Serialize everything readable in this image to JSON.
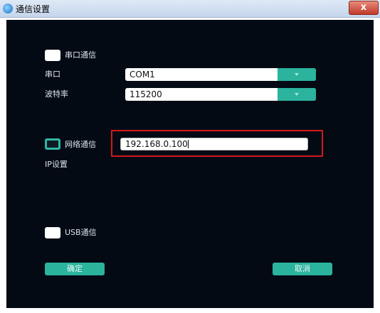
{
  "window": {
    "title": "通信设置",
    "close_label": "x"
  },
  "serial": {
    "checkbox_label": "串口通信",
    "port_label": "串口",
    "port_value": "COM1",
    "baud_label": "波特率",
    "baud_value": "115200"
  },
  "network": {
    "checkbox_label": "网络通信",
    "ip_label": "IP设置",
    "ip_value": "192.168.0.100"
  },
  "usb": {
    "checkbox_label": "USB通信"
  },
  "buttons": {
    "ok_label": "确定",
    "cancel_label": "取消"
  },
  "colors": {
    "accent": "#2bb39e",
    "background": "#030a14",
    "highlight": "#d01a1a"
  }
}
